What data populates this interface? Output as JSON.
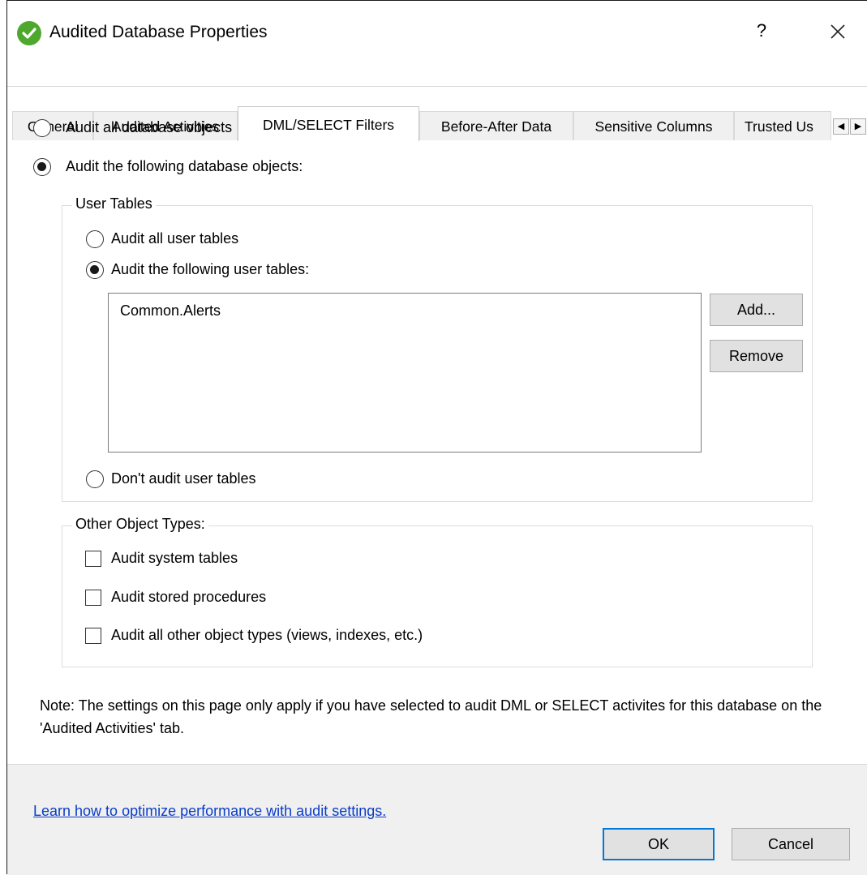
{
  "window": {
    "title": "Audited Database Properties",
    "help": "?",
    "accent": "#0078d7",
    "status_icon": "green-check-circle-icon"
  },
  "tabs": [
    {
      "label": "General",
      "active": false
    },
    {
      "label": "Audited Activities",
      "active": false
    },
    {
      "label": "DML/SELECT Filters",
      "active": true
    },
    {
      "label": "Before-After Data",
      "active": false
    },
    {
      "label": "Sensitive Columns",
      "active": false
    },
    {
      "label": "Trusted Us",
      "active": false
    }
  ],
  "scope": {
    "all_objects_label": "Audit all database objects",
    "following_objects_label": "Audit the following database objects:",
    "selected": "following"
  },
  "user_tables": {
    "group_label": "User Tables",
    "all_label": "Audit all user tables",
    "following_label": "Audit the following user tables:",
    "none_label": "Don't audit user tables",
    "selected": "following",
    "items": [
      "Common.Alerts"
    ],
    "add_button": "Add...",
    "remove_button": "Remove"
  },
  "other_types": {
    "group_label": "Other Object Types:",
    "system_tables_label": "Audit system tables",
    "stored_procedures_label": "Audit stored procedures",
    "other_label": "Audit all other object types (views, indexes, etc.)"
  },
  "note": "Note: The settings on this page only apply if you have selected to audit DML or SELECT activites for this database on the 'Audited Activities' tab.",
  "link": "Learn how to optimize performance with audit settings.",
  "buttons": {
    "ok": "OK",
    "cancel": "Cancel"
  }
}
